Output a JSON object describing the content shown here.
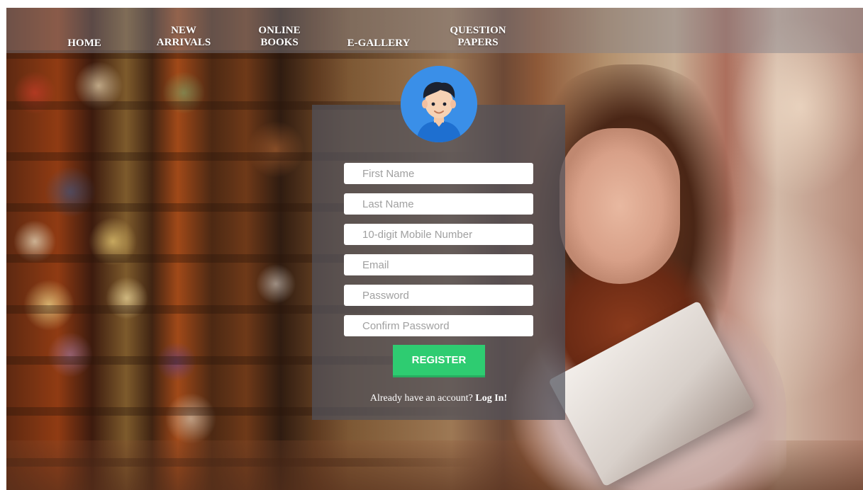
{
  "nav": {
    "items": [
      {
        "lines": [
          "HOME"
        ]
      },
      {
        "lines": [
          "NEW",
          "ARRIVALS"
        ]
      },
      {
        "lines": [
          "ONLINE",
          "BOOKS"
        ]
      },
      {
        "lines": [
          "E-GALLERY"
        ]
      },
      {
        "lines": [
          "QUESTION",
          "PAPERS"
        ]
      }
    ]
  },
  "register": {
    "fields": {
      "first_name": "First Name",
      "last_name": "Last Name",
      "mobile": "10-digit Mobile Number",
      "email": "Email",
      "password": "Password",
      "confirm_password": "Confirm Password"
    },
    "button_label": "REGISTER",
    "login_prompt": "Already have an account?",
    "login_link": "Log In!"
  },
  "icons": {
    "avatar": "user-avatar-icon"
  },
  "colors": {
    "accent_green": "#2ecc71",
    "avatar_blue": "#3a8fe8"
  }
}
